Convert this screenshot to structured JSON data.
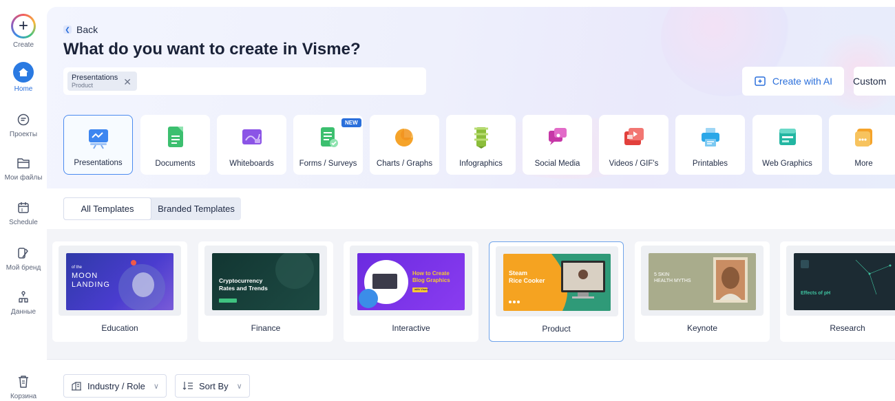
{
  "sidebar": {
    "items": [
      {
        "label": "Create",
        "icon": "plus-icon"
      },
      {
        "label": "Home",
        "icon": "home-icon"
      },
      {
        "label": "Проекты",
        "icon": "projects-icon"
      },
      {
        "label": "Мои файлы",
        "icon": "folder-icon"
      },
      {
        "label": "Schedule",
        "icon": "calendar-icon"
      },
      {
        "label": "Мой бренд",
        "icon": "brand-icon"
      },
      {
        "label": "Данные",
        "icon": "data-icon"
      },
      {
        "label": "Корзина",
        "icon": "trash-icon"
      }
    ]
  },
  "header": {
    "back_label": "Back",
    "title": "What do you want to create in Visme?"
  },
  "search": {
    "chip_title": "Presentations",
    "chip_subtitle": "Product"
  },
  "actions": {
    "ai_label": "Create with AI",
    "custom_label": "Custom"
  },
  "categories": [
    {
      "label": "Presentations",
      "icon": "presentation-icon",
      "selected": true
    },
    {
      "label": "Documents",
      "icon": "document-icon"
    },
    {
      "label": "Whiteboards",
      "icon": "whiteboard-icon"
    },
    {
      "label": "Forms / Surveys",
      "icon": "form-icon",
      "badge": "NEW"
    },
    {
      "label": "Charts / Graphs",
      "icon": "chart-icon"
    },
    {
      "label": "Infographics",
      "icon": "infographic-icon"
    },
    {
      "label": "Social Media",
      "icon": "social-icon"
    },
    {
      "label": "Videos / GIF's",
      "icon": "video-icon"
    },
    {
      "label": "Printables",
      "icon": "printer-icon"
    },
    {
      "label": "Web Graphics",
      "icon": "web-icon"
    },
    {
      "label": "More",
      "icon": "more-icon"
    }
  ],
  "tabs": [
    {
      "label": "All Templates",
      "active": true
    },
    {
      "label": "Branded Templates",
      "active": false
    }
  ],
  "templates": [
    {
      "label": "Education",
      "thumb_lines": [
        "of the",
        "MOON",
        "LANDING"
      ]
    },
    {
      "label": "Finance",
      "thumb_lines": [
        "Cryptocurrency",
        "Rates and Trends"
      ]
    },
    {
      "label": "Interactive",
      "thumb_lines": [
        "How to Create",
        "Blog Graphics",
        "with Visme"
      ]
    },
    {
      "label": "Product",
      "thumb_lines": [
        "Steam",
        "Rice Cooker"
      ],
      "selected": true
    },
    {
      "label": "Keynote",
      "thumb_lines": [
        "5 SKIN",
        "HEALTH MYTHS"
      ]
    },
    {
      "label": "Research",
      "thumb_lines": [
        "Effects of pH"
      ]
    }
  ],
  "filters": {
    "industry_label": "Industry / Role",
    "sort_label": "Sort By"
  },
  "colors": {
    "accent": "#2a6fdb",
    "hero_bg": "#eef0fc",
    "strip_bg": "#f3f4f8"
  }
}
